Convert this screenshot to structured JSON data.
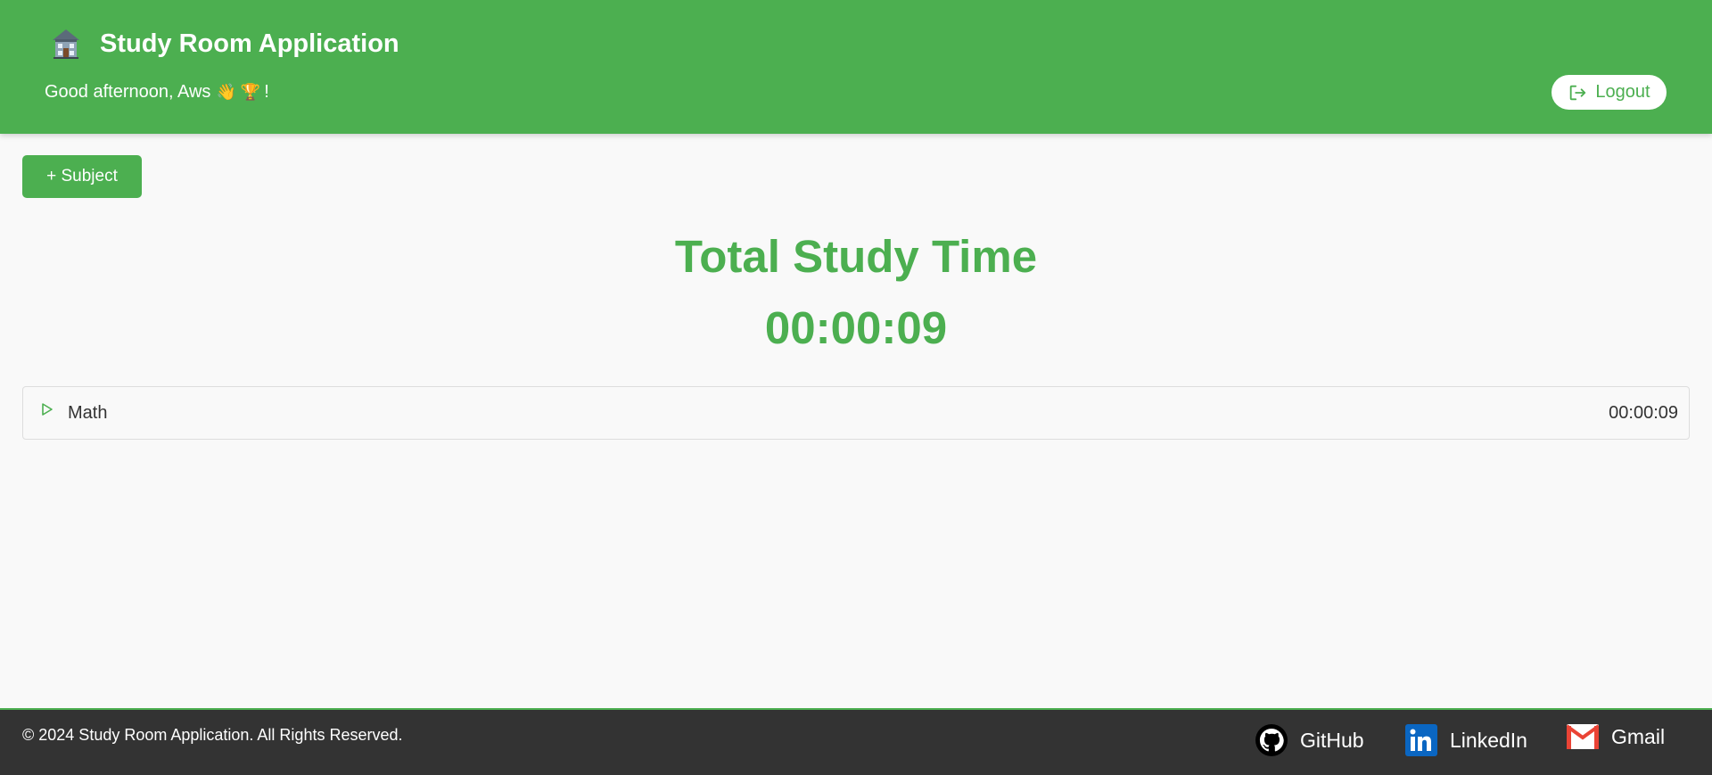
{
  "header": {
    "title": "Study Room Application",
    "brand_icon": "house-icon",
    "greeting": "Good afternoon, Aws",
    "greeting_emoji": "👋 🏆",
    "greeting_suffix": "!",
    "logout_label": "Logout",
    "accent_color": "#4caf50"
  },
  "main": {
    "add_subject_label": "+ Subject",
    "total_title": "Total Study Time",
    "total_time": "00:00:09",
    "subjects": [
      {
        "name": "Math",
        "time": "00:00:09",
        "icon": "play-icon"
      }
    ]
  },
  "footer": {
    "copyright": "© 2024 Study Room Application. All Rights Reserved.",
    "links": [
      {
        "label": "GitHub",
        "icon": "github-icon"
      },
      {
        "label": "LinkedIn",
        "icon": "linkedin-icon"
      },
      {
        "label": "Gmail",
        "icon": "gmail-icon"
      }
    ],
    "background": "#333333"
  }
}
